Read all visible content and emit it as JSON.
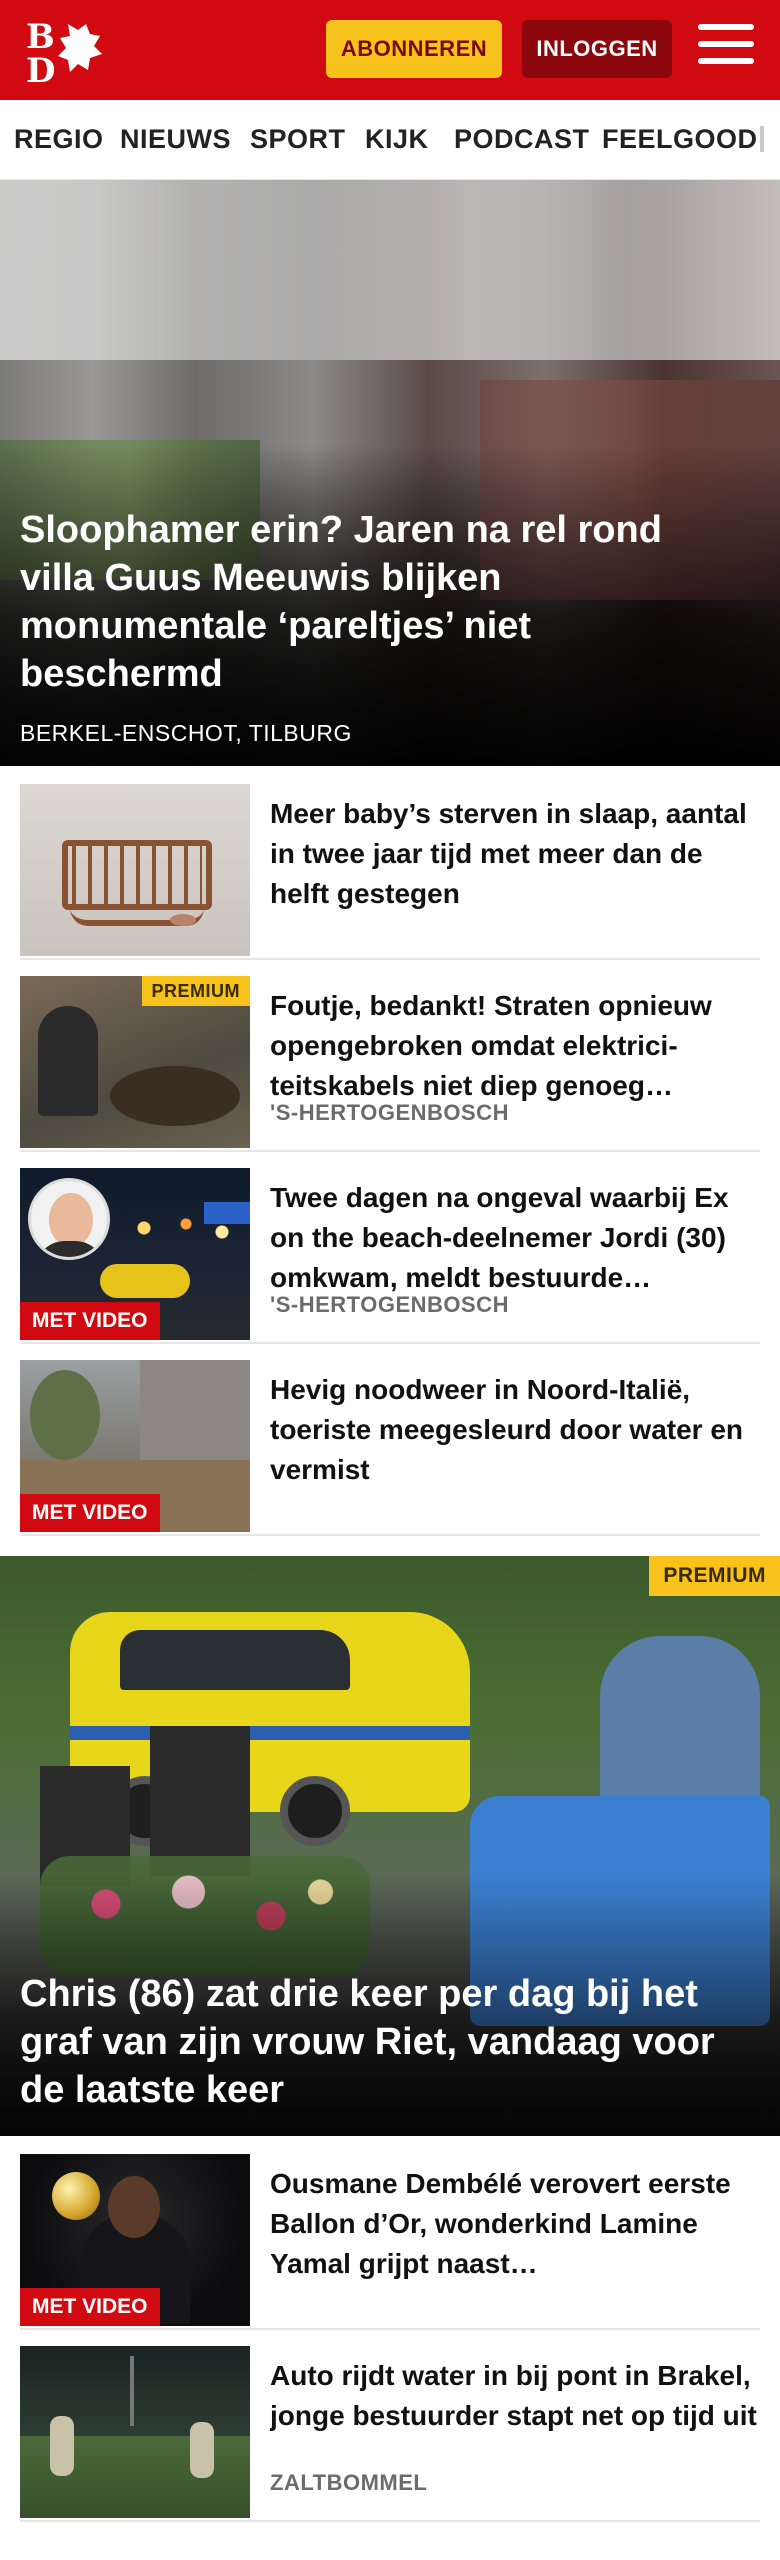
{
  "header": {
    "logo_text": "BD",
    "subscribe_label": "ABONNEREN",
    "login_label": "INLOGGEN",
    "menu_icon": "hamburger-menu-icon",
    "brand_color": "#d10a11",
    "subscribe_color": "#f7c21b"
  },
  "nav": {
    "items": [
      "REGIO",
      "NIEUWS",
      "SPORT",
      "KIJK",
      "PODCAST",
      "FEELGOOD"
    ]
  },
  "hero": {
    "title": "Sloophamer erin? Jaren na rel rond villa Guus Meeuwis blijken monumentale ‘pareltjes’ niet beschermd",
    "location": "BERKEL-ENSCHOT, TILBURG"
  },
  "articles": [
    {
      "title": "Meer baby’s sterven in slaap, aantal in twee jaar tijd met meer dan de helft gestegen",
      "location": "",
      "badge": ""
    },
    {
      "title": "Foutje, bedankt! Straten opnieuw opengebroken omdat elektrici­teitskabels niet diep genoeg…",
      "location": "'S-HERTOGENBOSCH",
      "badge": "PREMIUM"
    },
    {
      "title": "Twee dagen na ongeval waarbij Ex on the beach-deelnemer Jordi (30) omkwam, meldt bestuurde…",
      "location": "'S-HERTOGENBOSCH",
      "badge": "MET VIDEO"
    },
    {
      "title": "Hevig noodweer in Noord-Italië, toeriste meegesleurd door water en vermist",
      "location": "",
      "badge": "MET VIDEO"
    }
  ],
  "feature": {
    "title": "Chris (86) zat drie keer per dag bij het graf van zijn vrouw Riet, vandaag voor de laatste keer",
    "badge": "PREMIUM"
  },
  "articles2": [
    {
      "title": "Ousmane Dembélé verovert eerste Ballon d’Or, wonderkind Lamine Yamal grijpt naast…",
      "location": "",
      "badge": "MET VIDEO"
    },
    {
      "title": "Auto rijdt water in bij pont in Brakel, jonge bestuurder stapt net op tijd uit",
      "location": "ZALTBOMMEL",
      "badge": ""
    }
  ]
}
